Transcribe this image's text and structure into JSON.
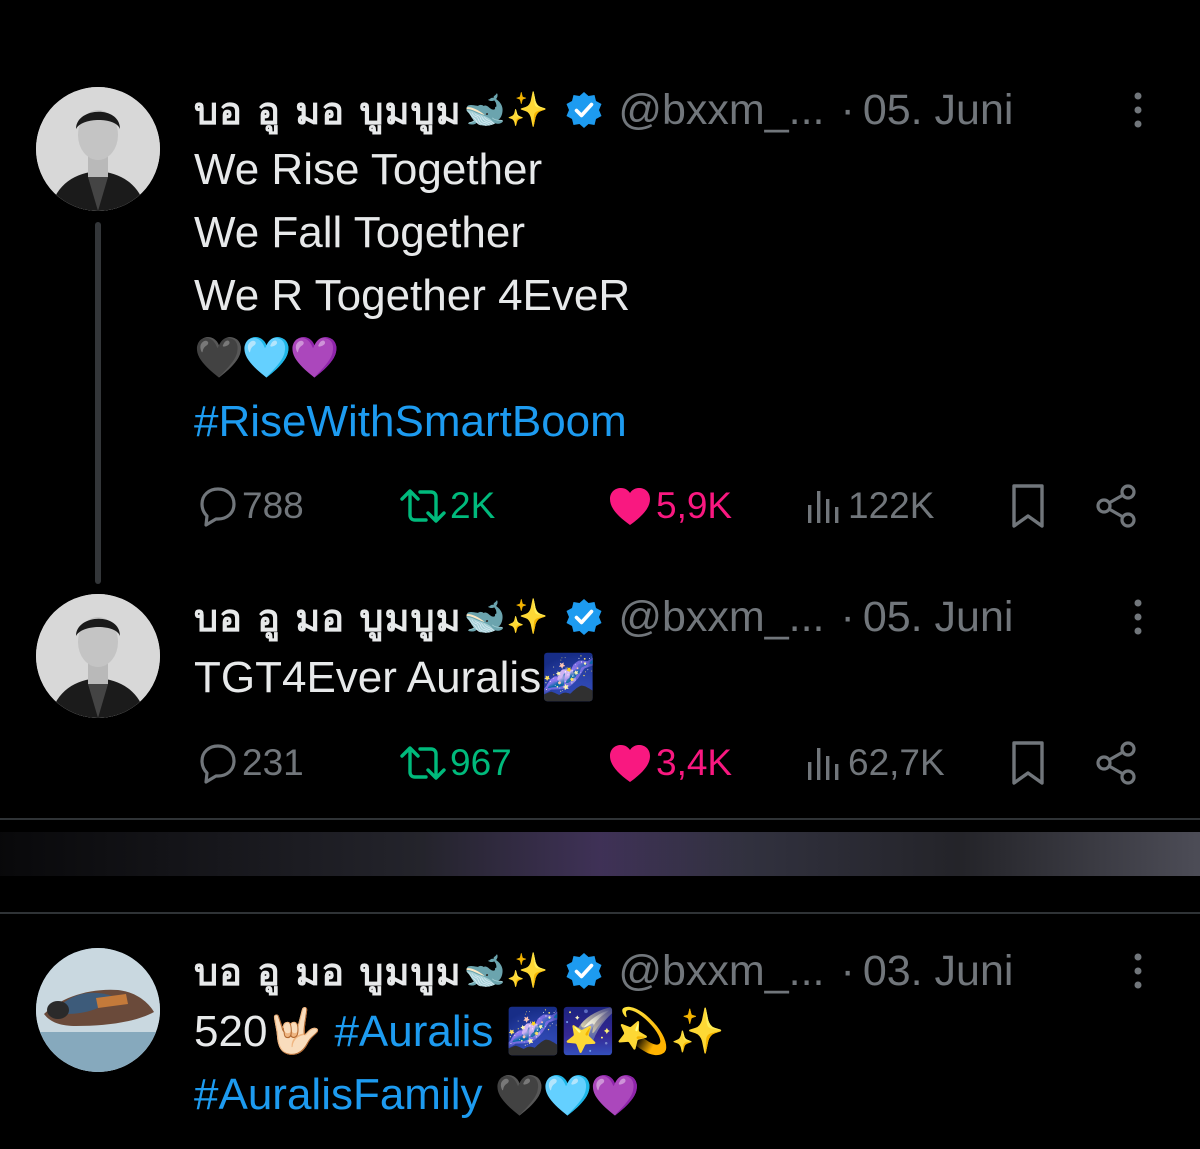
{
  "tweets": [
    {
      "display_name": "บอ อู มอ บูมบูม",
      "name_emoji": "🐋✨",
      "handle": "@bxxm_...",
      "separator": "·",
      "date": "05. Juni",
      "lines": [
        "We Rise Together",
        "We Fall Together",
        "We R Together 4EveR"
      ],
      "hearts": "🖤🩵💜",
      "hashtag": "#RiseWithSmartBoom",
      "replies": "788",
      "retweets": "2K",
      "likes": "5,9K",
      "views": "122K"
    },
    {
      "display_name": "บอ อู มอ บูมบูม",
      "name_emoji": "🐋✨",
      "handle": "@bxxm_...",
      "separator": "·",
      "date": "05. Juni",
      "text": "TGT4Ever Auralis",
      "text_emoji": "🌌",
      "replies": "231",
      "retweets": "967",
      "likes": "3,4K",
      "views": "62,7K"
    },
    {
      "display_name": "บอ อู มอ บูมบูม",
      "name_emoji": "🐋✨",
      "handle": "@bxxm_...",
      "separator": "·",
      "date": "03. Juni",
      "text_prefix": "520",
      "text_prefix_emoji": "🤟🏻",
      "hashtag1": "#Auralis",
      "emojis1": "🌌🌠💫✨",
      "hashtag2": "#AuralisFamily",
      "hearts": "🖤🩵💜"
    }
  ],
  "icons": {
    "verified": "verified-badge-icon",
    "more": "more-vertical-icon",
    "reply": "reply-icon",
    "retweet": "retweet-icon",
    "like": "heart-icon",
    "views": "views-icon",
    "bookmark": "bookmark-icon",
    "share": "share-icon"
  },
  "colors": {
    "background": "#000000",
    "text": "#e7e9ea",
    "muted": "#71767b",
    "accent": "#1d9bf0",
    "retweet": "#00ba7c",
    "like": "#f91880"
  }
}
